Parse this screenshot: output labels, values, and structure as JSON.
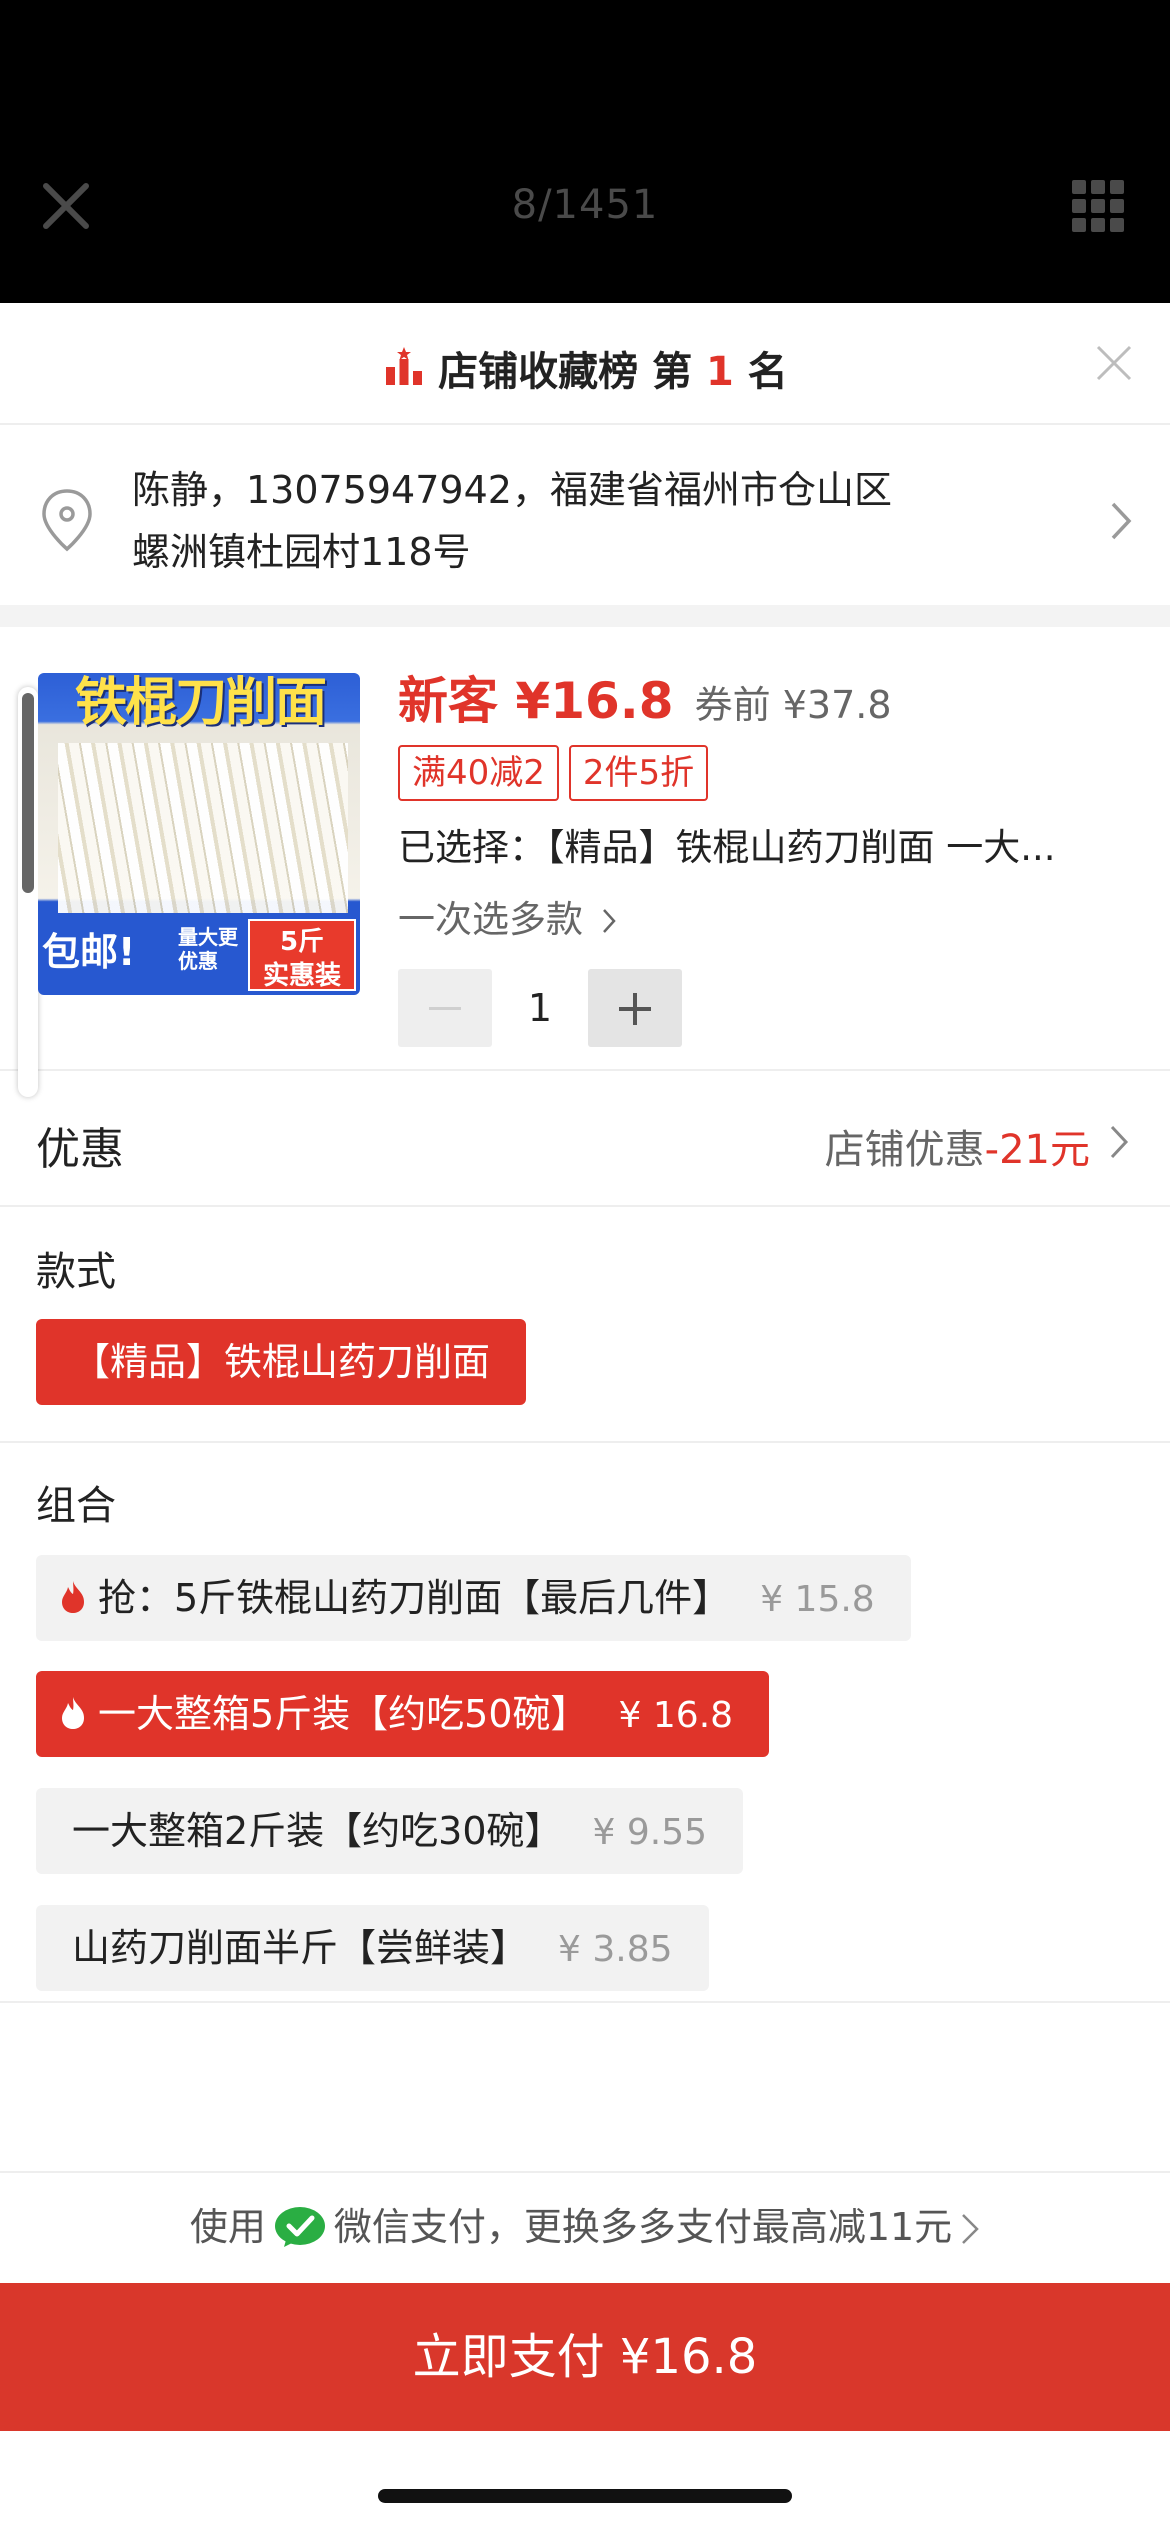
{
  "viewer": {
    "counter": "8/1451",
    "close_icon": "close-icon",
    "grid_icon": "grid-icon"
  },
  "rank": {
    "text_before": "店铺收藏榜 第 ",
    "rank_number": "1",
    "text_after": " 名",
    "icon": "bar-chart-star-icon",
    "close_icon": "close-icon"
  },
  "address": {
    "line1": "陈静，13075947942，福建省福州市仓山区",
    "line2": "螺洲镇杜园村118号",
    "icon": "location-pin-icon"
  },
  "product": {
    "image_title": "铁棍刀削面",
    "image_badge_left": "包邮!",
    "image_badge_mid": "量大更优惠",
    "image_badge_right_1": "5斤",
    "image_badge_right_2": "实惠装",
    "new_price": "新客 ¥16.8",
    "old_price": "券前 ¥37.8",
    "tags": [
      "满40减2",
      "2件5折"
    ],
    "selected": "已选择：【精品】铁棍山药刀削面 一大...",
    "multi_select": "一次选多款",
    "quantity": "1"
  },
  "discount": {
    "label": "优惠",
    "value_prefix": "店铺优惠",
    "value_amount": "-21元"
  },
  "style": {
    "title": "款式",
    "options": [
      {
        "label": "【精品】铁棍山药刀削面",
        "selected": true
      }
    ]
  },
  "combo": {
    "title": "组合",
    "options": [
      {
        "label": "抢：5斤铁棍山药刀削面【最后几件】",
        "price": "¥ 15.8",
        "selected": false,
        "hot": true
      },
      {
        "label": "一大整箱5斤装【约吃50碗】",
        "price": "¥ 16.8",
        "selected": true,
        "hot": true
      },
      {
        "label": "一大整箱2斤装【约吃30碗】",
        "price": "¥ 9.55",
        "selected": false,
        "hot": false
      },
      {
        "label": "山药刀削面半斤【尝鲜装】",
        "price": "¥ 3.85",
        "selected": false,
        "hot": false
      }
    ]
  },
  "payment": {
    "notice_before": "使用",
    "notice_after": "微信支付，更换多多支付最高减11元",
    "button": "立即支付 ¥16.8"
  },
  "colors": {
    "accent": "#e0342a",
    "pay_button": "#d9372b",
    "wechat_green": "#2aae43"
  }
}
